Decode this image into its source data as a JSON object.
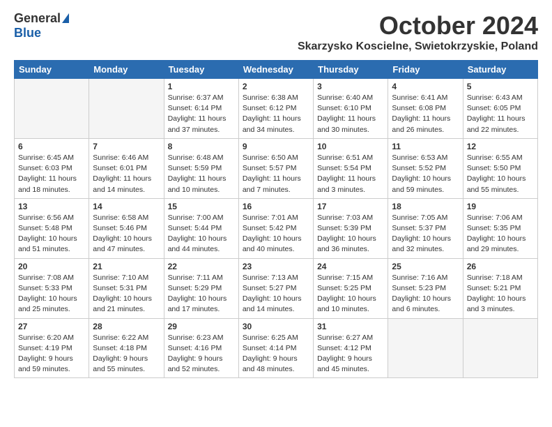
{
  "header": {
    "logo_general": "General",
    "logo_blue": "Blue",
    "month_title": "October 2024",
    "location": "Skarzysko Koscielne, Swietokrzyskie, Poland"
  },
  "days_of_week": [
    "Sunday",
    "Monday",
    "Tuesday",
    "Wednesday",
    "Thursday",
    "Friday",
    "Saturday"
  ],
  "weeks": [
    [
      {
        "day": "",
        "empty": true
      },
      {
        "day": "",
        "empty": true
      },
      {
        "day": "1",
        "sunrise": "6:37 AM",
        "sunset": "6:14 PM",
        "daylight": "11 hours and 37 minutes."
      },
      {
        "day": "2",
        "sunrise": "6:38 AM",
        "sunset": "6:12 PM",
        "daylight": "11 hours and 34 minutes."
      },
      {
        "day": "3",
        "sunrise": "6:40 AM",
        "sunset": "6:10 PM",
        "daylight": "11 hours and 30 minutes."
      },
      {
        "day": "4",
        "sunrise": "6:41 AM",
        "sunset": "6:08 PM",
        "daylight": "11 hours and 26 minutes."
      },
      {
        "day": "5",
        "sunrise": "6:43 AM",
        "sunset": "6:05 PM",
        "daylight": "11 hours and 22 minutes."
      }
    ],
    [
      {
        "day": "6",
        "sunrise": "6:45 AM",
        "sunset": "6:03 PM",
        "daylight": "11 hours and 18 minutes."
      },
      {
        "day": "7",
        "sunrise": "6:46 AM",
        "sunset": "6:01 PM",
        "daylight": "11 hours and 14 minutes."
      },
      {
        "day": "8",
        "sunrise": "6:48 AM",
        "sunset": "5:59 PM",
        "daylight": "11 hours and 10 minutes."
      },
      {
        "day": "9",
        "sunrise": "6:50 AM",
        "sunset": "5:57 PM",
        "daylight": "11 hours and 7 minutes."
      },
      {
        "day": "10",
        "sunrise": "6:51 AM",
        "sunset": "5:54 PM",
        "daylight": "11 hours and 3 minutes."
      },
      {
        "day": "11",
        "sunrise": "6:53 AM",
        "sunset": "5:52 PM",
        "daylight": "10 hours and 59 minutes."
      },
      {
        "day": "12",
        "sunrise": "6:55 AM",
        "sunset": "5:50 PM",
        "daylight": "10 hours and 55 minutes."
      }
    ],
    [
      {
        "day": "13",
        "sunrise": "6:56 AM",
        "sunset": "5:48 PM",
        "daylight": "10 hours and 51 minutes."
      },
      {
        "day": "14",
        "sunrise": "6:58 AM",
        "sunset": "5:46 PM",
        "daylight": "10 hours and 47 minutes."
      },
      {
        "day": "15",
        "sunrise": "7:00 AM",
        "sunset": "5:44 PM",
        "daylight": "10 hours and 44 minutes."
      },
      {
        "day": "16",
        "sunrise": "7:01 AM",
        "sunset": "5:42 PM",
        "daylight": "10 hours and 40 minutes."
      },
      {
        "day": "17",
        "sunrise": "7:03 AM",
        "sunset": "5:39 PM",
        "daylight": "10 hours and 36 minutes."
      },
      {
        "day": "18",
        "sunrise": "7:05 AM",
        "sunset": "5:37 PM",
        "daylight": "10 hours and 32 minutes."
      },
      {
        "day": "19",
        "sunrise": "7:06 AM",
        "sunset": "5:35 PM",
        "daylight": "10 hours and 29 minutes."
      }
    ],
    [
      {
        "day": "20",
        "sunrise": "7:08 AM",
        "sunset": "5:33 PM",
        "daylight": "10 hours and 25 minutes."
      },
      {
        "day": "21",
        "sunrise": "7:10 AM",
        "sunset": "5:31 PM",
        "daylight": "10 hours and 21 minutes."
      },
      {
        "day": "22",
        "sunrise": "7:11 AM",
        "sunset": "5:29 PM",
        "daylight": "10 hours and 17 minutes."
      },
      {
        "day": "23",
        "sunrise": "7:13 AM",
        "sunset": "5:27 PM",
        "daylight": "10 hours and 14 minutes."
      },
      {
        "day": "24",
        "sunrise": "7:15 AM",
        "sunset": "5:25 PM",
        "daylight": "10 hours and 10 minutes."
      },
      {
        "day": "25",
        "sunrise": "7:16 AM",
        "sunset": "5:23 PM",
        "daylight": "10 hours and 6 minutes."
      },
      {
        "day": "26",
        "sunrise": "7:18 AM",
        "sunset": "5:21 PM",
        "daylight": "10 hours and 3 minutes."
      }
    ],
    [
      {
        "day": "27",
        "sunrise": "6:20 AM",
        "sunset": "4:19 PM",
        "daylight": "9 hours and 59 minutes."
      },
      {
        "day": "28",
        "sunrise": "6:22 AM",
        "sunset": "4:18 PM",
        "daylight": "9 hours and 55 minutes."
      },
      {
        "day": "29",
        "sunrise": "6:23 AM",
        "sunset": "4:16 PM",
        "daylight": "9 hours and 52 minutes."
      },
      {
        "day": "30",
        "sunrise": "6:25 AM",
        "sunset": "4:14 PM",
        "daylight": "9 hours and 48 minutes."
      },
      {
        "day": "31",
        "sunrise": "6:27 AM",
        "sunset": "4:12 PM",
        "daylight": "9 hours and 45 minutes."
      },
      {
        "day": "",
        "empty": true
      },
      {
        "day": "",
        "empty": true
      }
    ]
  ]
}
